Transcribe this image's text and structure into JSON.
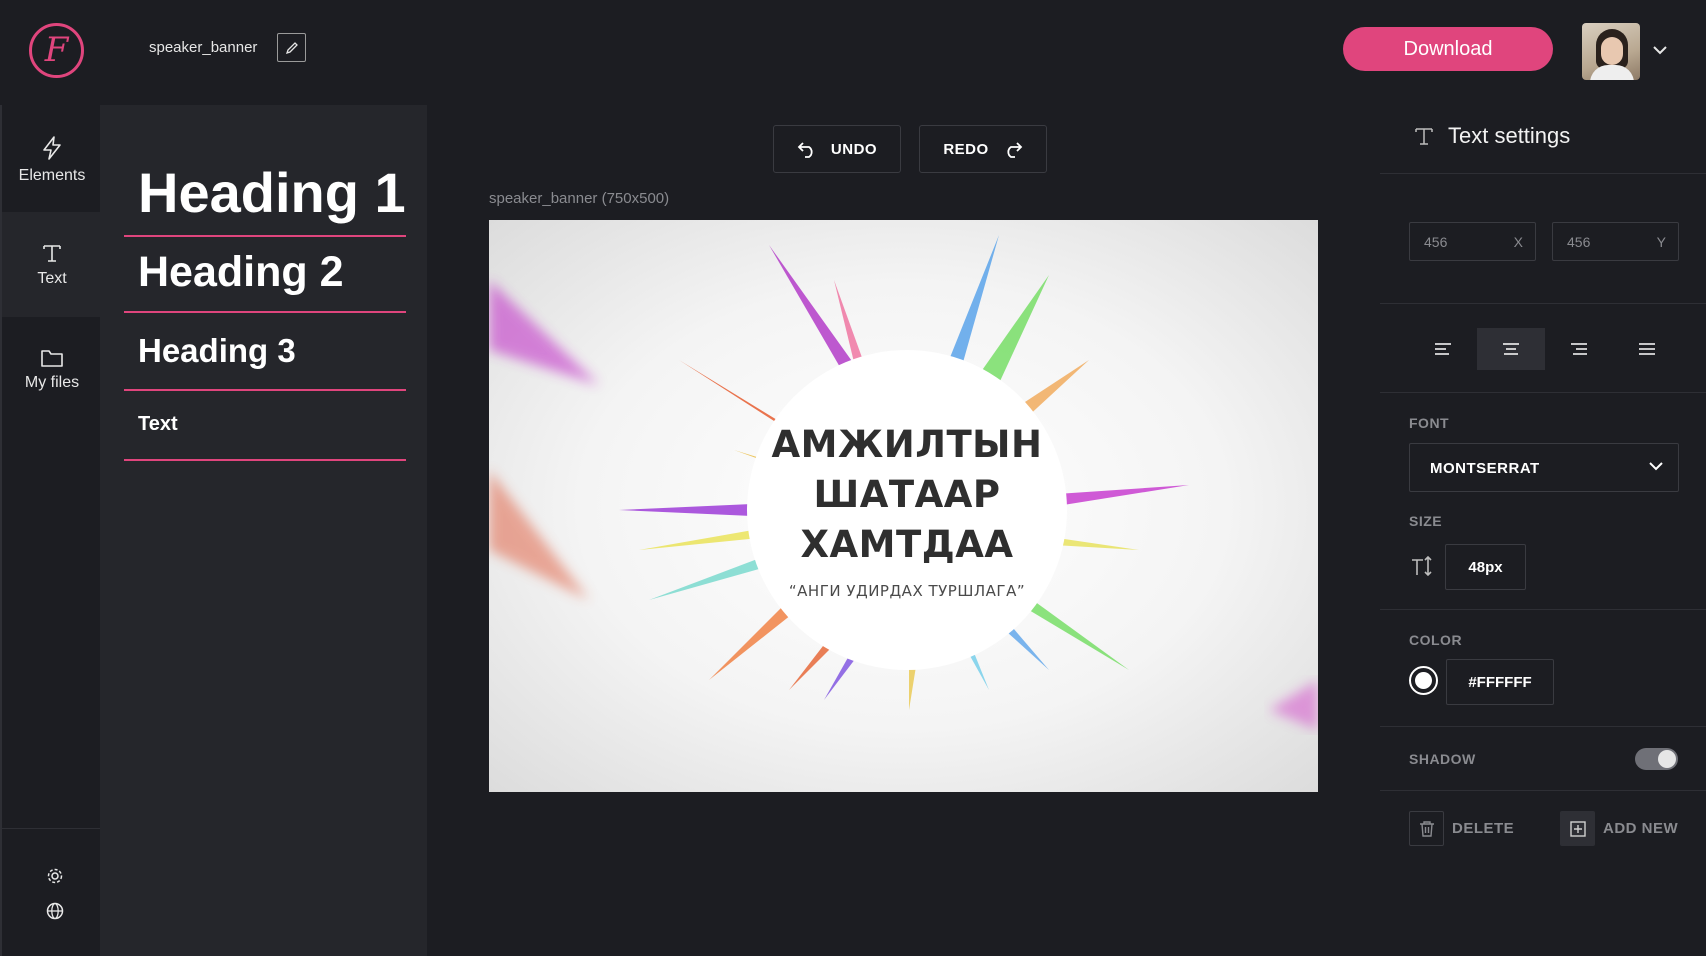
{
  "app": {
    "logo_letter": "F"
  },
  "header": {
    "filename": "speaker_banner",
    "download_label": "Download"
  },
  "nav": {
    "items": [
      {
        "label": "Elements",
        "icon": "lightning-icon"
      },
      {
        "label": "Text",
        "icon": "text-icon"
      },
      {
        "label": "My files",
        "icon": "folder-icon"
      }
    ],
    "active": "Text",
    "bottom_icons": [
      "settings-icon",
      "globe-icon"
    ]
  },
  "text_presets": [
    "Heading 1",
    "Heading 2",
    "Heading 3",
    "Text"
  ],
  "toolbar": {
    "undo_label": "UNDO",
    "redo_label": "REDO"
  },
  "canvas": {
    "label": "speaker_banner (750x500)",
    "lines": [
      "АМЖИЛТЫН",
      "ШАТААР",
      "ХАМТДАА"
    ],
    "subtitle": "“АНГИ  УДИРДАХ ТУРШЛАГА”"
  },
  "settings": {
    "title": "Text settings",
    "x_value": "456",
    "x_axis": "X",
    "y_value": "456",
    "y_axis": "Y",
    "alignment_options": [
      "left",
      "center",
      "right",
      "justify"
    ],
    "alignment_selected": "center",
    "font_label": "FONT",
    "font_value": "MONTSERRAT",
    "size_label": "SIZE",
    "size_value": "48px",
    "color_label": "COLOR",
    "color_value": "#FFFFFF",
    "shadow_label": "SHADOW",
    "shadow_on": true,
    "delete_label": "DELETE",
    "add_new_label": "ADD NEW"
  },
  "colors": {
    "accent": "#e0457d",
    "background": "#1c1d22",
    "panel": "#25262b"
  }
}
